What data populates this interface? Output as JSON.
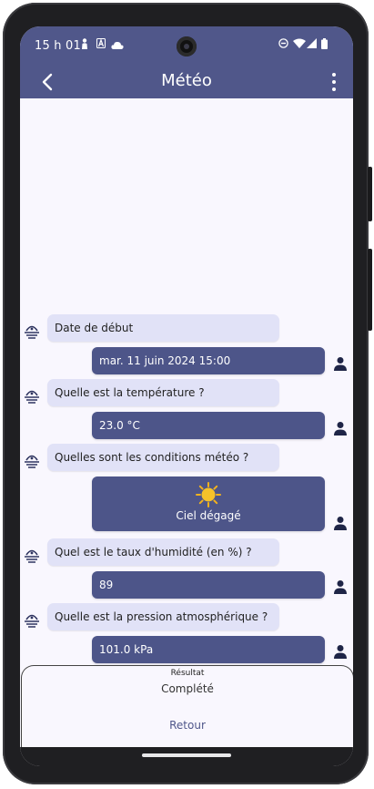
{
  "status_bar": {
    "time": "15 h 01",
    "left_icons": [
      "person-icon",
      "a-box-icon",
      "cloud-icon"
    ],
    "right_icons": [
      "dnd-icon",
      "wifi-icon",
      "signal-icon",
      "battery-icon"
    ]
  },
  "app_bar": {
    "title": "Météo"
  },
  "chat": {
    "messages": [
      {
        "question": "Date de début",
        "answer": "mar. 11 juin 2024 15:00"
      },
      {
        "question": "Quelle est la température ?",
        "answer": "23.0 °C"
      },
      {
        "question": "Quelles sont les conditions météo ?",
        "answer": "Ciel dégagé",
        "answer_icon": "sun-icon"
      },
      {
        "question": "Quel est le taux d'humidité (en %) ?",
        "answer": "89"
      },
      {
        "question": "Quelle est la pression atmosphérique ?",
        "answer": "101.0 kPa"
      }
    ]
  },
  "result": {
    "label": "Résultat",
    "value": "Complété",
    "back_label": "Retour"
  },
  "colors": {
    "primary": "#50578a",
    "question_bubble": "#e1e2f7",
    "answer_bubble": "#4d5589",
    "background": "#f9f7fe"
  }
}
